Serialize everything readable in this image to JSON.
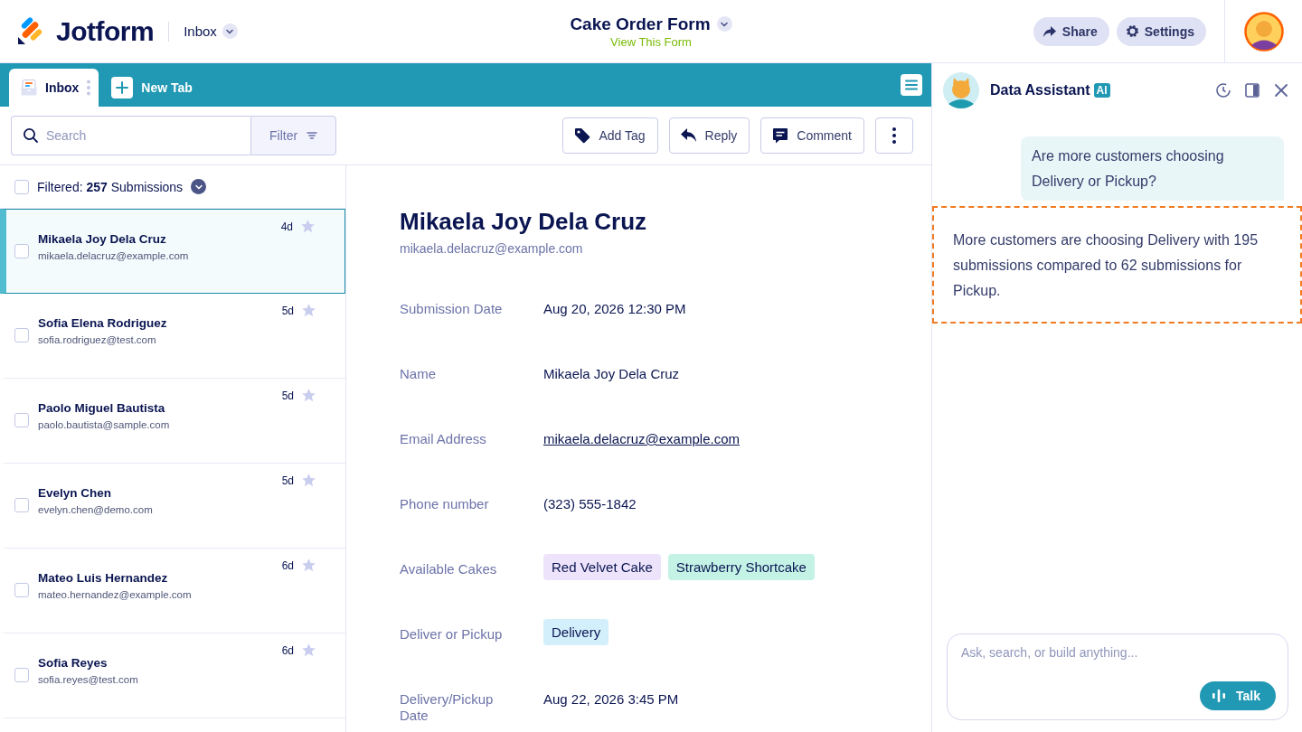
{
  "header": {
    "logo": "Jotform",
    "section": "Inbox",
    "form_title": "Cake Order Form",
    "form_link": "View This Form",
    "buttons": [
      {
        "label": "Share",
        "kind": "share"
      },
      {
        "label": "Settings",
        "kind": "settings"
      }
    ]
  },
  "tabs": [
    {
      "label": "Inbox",
      "selected": true
    }
  ],
  "new_tab_button": "New Tab",
  "toolbar": {
    "search": {
      "placeholder": "Search"
    },
    "filter": "Filter",
    "actions": [
      {
        "label": "Add Tag",
        "kind": "tag"
      },
      {
        "label": "Reply",
        "kind": "reply"
      },
      {
        "label": "Comment",
        "kind": "comment"
      }
    ]
  },
  "list_header": {
    "checked": false,
    "text": "Filtered: **257** Submissions"
  },
  "submissions": [
    {
      "name": "Mikaela Joy Dela Cruz",
      "email": "mikaela.delacruz@example.com",
      "age": "4d",
      "selected": true,
      "checked": false,
      "starred": false
    },
    {
      "name": "Sofia Elena Rodriguez",
      "email": "sofia.rodriguez@test.com",
      "age": "5d",
      "selected": false,
      "checked": false,
      "starred": false
    },
    {
      "name": "Paolo Miguel Bautista",
      "email": "paolo.bautista@sample.com",
      "age": "5d",
      "selected": false,
      "checked": false,
      "starred": false
    },
    {
      "name": "Evelyn Chen",
      "email": "evelyn.chen@demo.com",
      "age": "5d",
      "selected": false,
      "checked": false,
      "starred": false
    },
    {
      "name": "Mateo Luis Hernandez",
      "email": "mateo.hernandez@example.com",
      "age": "6d",
      "selected": false,
      "checked": false,
      "starred": false
    },
    {
      "name": "Sofia Reyes",
      "email": "sofia.reyes@test.com",
      "age": "6d",
      "selected": false,
      "checked": false,
      "starred": false
    }
  ],
  "detail": {
    "name": "Mikaela Joy Dela Cruz",
    "email": "mikaela.delacruz@example.com",
    "fields": [
      {
        "label": "Submission Date",
        "kind": "text",
        "value": "Aug 20, 2026 12:30 PM"
      },
      {
        "label": "Name",
        "kind": "text",
        "value": "Mikaela Joy Dela Cruz"
      },
      {
        "label": "Email Address",
        "kind": "link",
        "value": "mikaela.delacruz@example.com"
      },
      {
        "label": "Phone number",
        "kind": "text",
        "value": "(323) 555-1842"
      },
      {
        "label": "Available Cakes",
        "kind": "tags",
        "tags": [
          {
            "label": "Red Velvet Cake",
            "color": "#ede3fb"
          },
          {
            "label": "Strawberry Shortcake",
            "color": "#c4f3e6"
          }
        ]
      },
      {
        "label": "Deliver or Pickup",
        "kind": "tags",
        "tags": [
          {
            "label": "Delivery",
            "color": "#d3effb"
          }
        ]
      },
      {
        "label": "Delivery/Pickup Date",
        "kind": "text",
        "value": "Aug 22, 2026 3:45 PM"
      }
    ]
  },
  "assistant": {
    "title": "Data Assistant",
    "badge": "AI",
    "messages": [
      {
        "kind": "user",
        "text": "Are more customers choosing Delivery or Pickup?",
        "highlighted": false
      },
      {
        "kind": "assistant",
        "text": "More customers are choosing Delivery with 195 submissions compared to 62 submissions for Pickup.",
        "highlighted": true
      }
    ],
    "input": {
      "placeholder": "Ask, search, or build anything..."
    },
    "talk_button": "Talk"
  }
}
